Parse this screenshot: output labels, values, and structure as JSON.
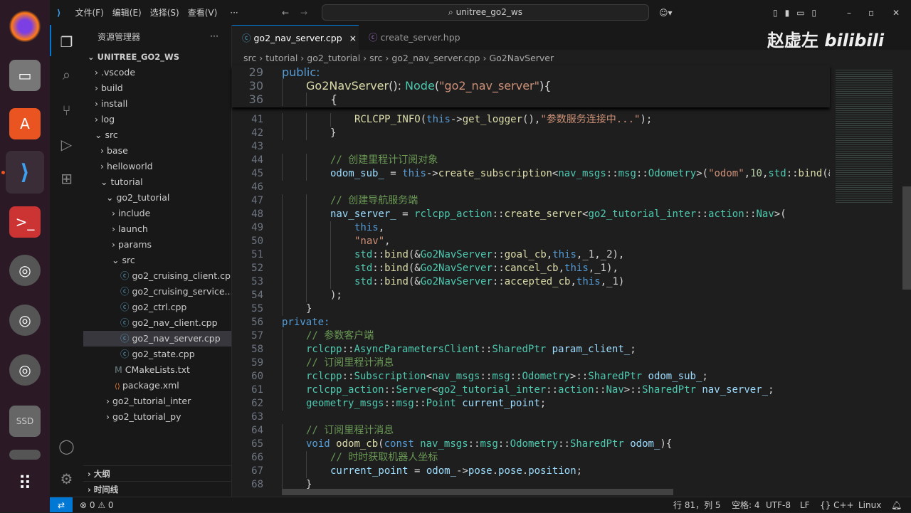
{
  "dock": {
    "items": [
      "firefox",
      "files",
      "app-center",
      "vscode",
      "terminal",
      "disk1",
      "disk2",
      "disk3",
      "ssd",
      "trash",
      "apps"
    ]
  },
  "titlebar": {
    "menus": [
      "文件(F)",
      "编辑(E)",
      "选择(S)",
      "查看(V)",
      "···"
    ],
    "search": "unitree_go2_ws"
  },
  "watermark": {
    "author": "赵虚左",
    "site": "bilibili"
  },
  "sidebar": {
    "title": "资源管理器",
    "more": "···",
    "root": "UNITREE_GO2_WS",
    "items": [
      {
        "label": ".vscode",
        "depth": 1,
        "kind": "folder",
        "open": false
      },
      {
        "label": "build",
        "depth": 1,
        "kind": "folder",
        "open": false
      },
      {
        "label": "install",
        "depth": 1,
        "kind": "folder",
        "open": false
      },
      {
        "label": "log",
        "depth": 1,
        "kind": "folder",
        "open": false
      },
      {
        "label": "src",
        "depth": 1,
        "kind": "folder",
        "open": true
      },
      {
        "label": "base",
        "depth": 2,
        "kind": "folder",
        "open": false
      },
      {
        "label": "helloworld",
        "depth": 2,
        "kind": "folder",
        "open": false
      },
      {
        "label": "tutorial",
        "depth": 2,
        "kind": "folder",
        "open": true
      },
      {
        "label": "go2_tutorial",
        "depth": 3,
        "kind": "folder",
        "open": true
      },
      {
        "label": "include",
        "depth": 4,
        "kind": "folder",
        "open": false
      },
      {
        "label": "launch",
        "depth": 4,
        "kind": "folder",
        "open": false
      },
      {
        "label": "params",
        "depth": 4,
        "kind": "folder",
        "open": false
      },
      {
        "label": "src",
        "depth": 4,
        "kind": "folder",
        "open": true
      },
      {
        "label": "go2_cruising_client.cpp",
        "depth": 5,
        "kind": "cpp"
      },
      {
        "label": "go2_cruising_service....",
        "depth": 5,
        "kind": "cpp"
      },
      {
        "label": "go2_ctrl.cpp",
        "depth": 5,
        "kind": "cpp"
      },
      {
        "label": "go2_nav_client.cpp",
        "depth": 5,
        "kind": "cpp"
      },
      {
        "label": "go2_nav_server.cpp",
        "depth": 5,
        "kind": "cpp",
        "active": true
      },
      {
        "label": "go2_state.cpp",
        "depth": 5,
        "kind": "cpp"
      },
      {
        "label": "CMakeLists.txt",
        "depth": 4,
        "kind": "cmake"
      },
      {
        "label": "package.xml",
        "depth": 4,
        "kind": "xml"
      },
      {
        "label": "go2_tutorial_inter",
        "depth": 3,
        "kind": "folder",
        "open": false
      },
      {
        "label": "go2_tutorial_py",
        "depth": 3,
        "kind": "folder",
        "open": false
      }
    ],
    "outline": "大纲",
    "timeline": "时间线"
  },
  "tabs": [
    {
      "label": "go2_nav_server.cpp",
      "active": true,
      "close": "×"
    },
    {
      "label": "create_server.hpp",
      "active": false
    }
  ],
  "breadcrumb": [
    "src",
    "tutorial",
    "go2_tutorial",
    "src",
    "go2_nav_server.cpp",
    "Go2NavServer"
  ],
  "sticky": [
    {
      "n": "29",
      "i": 0,
      "tok": [
        [
          "k",
          "public:"
        ]
      ]
    },
    {
      "n": "30",
      "i": 1,
      "tok": [
        [
          "f",
          "Go2NavServer"
        ],
        [
          "p",
          "(): "
        ],
        [
          "t",
          "Node"
        ],
        [
          "p",
          "("
        ],
        [
          "s",
          "\"go2_nav_server\""
        ],
        [
          "p",
          "){"
        ]
      ]
    },
    {
      "n": "36",
      "i": 2,
      "tok": [
        [
          "p",
          "{"
        ]
      ]
    }
  ],
  "code": [
    {
      "n": "41",
      "i": 3,
      "tok": [
        [
          "f",
          "RCLCPP_INFO"
        ],
        [
          "p",
          "("
        ],
        [
          "k",
          "this"
        ],
        [
          "p",
          "->"
        ],
        [
          "f",
          "get_logger"
        ],
        [
          "p",
          "(),"
        ],
        [
          "s",
          "\"参数服务连接中...\""
        ],
        [
          "p",
          ");"
        ]
      ]
    },
    {
      "n": "42",
      "i": 2,
      "tok": [
        [
          "p",
          "}"
        ]
      ]
    },
    {
      "n": "43",
      "i": 0,
      "tok": []
    },
    {
      "n": "44",
      "i": 2,
      "tok": [
        [
          "c",
          "// 创建里程计订阅对象"
        ]
      ]
    },
    {
      "n": "45",
      "i": 2,
      "tok": [
        [
          "v",
          "odom_sub_"
        ],
        [
          "p",
          " = "
        ],
        [
          "k",
          "this"
        ],
        [
          "p",
          "->"
        ],
        [
          "f",
          "create_subscription"
        ],
        [
          "p",
          "<"
        ],
        [
          "t",
          "nav_msgs"
        ],
        [
          "p",
          "::"
        ],
        [
          "t",
          "msg"
        ],
        [
          "p",
          "::"
        ],
        [
          "t",
          "Odometry"
        ],
        [
          "p",
          ">("
        ],
        [
          "s",
          "\"odom\""
        ],
        [
          "p",
          ","
        ],
        [
          "n",
          "10"
        ],
        [
          "p",
          ","
        ],
        [
          "t",
          "std"
        ],
        [
          "p",
          "::"
        ],
        [
          "f",
          "bind"
        ],
        [
          "p",
          "(&"
        ]
      ]
    },
    {
      "n": "46",
      "i": 0,
      "tok": []
    },
    {
      "n": "47",
      "i": 2,
      "tok": [
        [
          "c",
          "// 创建导航服务端"
        ]
      ]
    },
    {
      "n": "48",
      "i": 2,
      "tok": [
        [
          "v",
          "nav_server_"
        ],
        [
          "p",
          " = "
        ],
        [
          "t",
          "rclcpp_action"
        ],
        [
          "p",
          "::"
        ],
        [
          "f",
          "create_server"
        ],
        [
          "p",
          "<"
        ],
        [
          "t",
          "go2_tutorial_inter"
        ],
        [
          "p",
          "::"
        ],
        [
          "t",
          "action"
        ],
        [
          "p",
          "::"
        ],
        [
          "t",
          "Nav"
        ],
        [
          "p",
          ">("
        ]
      ]
    },
    {
      "n": "49",
      "i": 3,
      "tok": [
        [
          "k",
          "this"
        ],
        [
          "p",
          ","
        ]
      ]
    },
    {
      "n": "50",
      "i": 3,
      "tok": [
        [
          "s",
          "\"nav\""
        ],
        [
          "p",
          ","
        ]
      ]
    },
    {
      "n": "51",
      "i": 3,
      "tok": [
        [
          "t",
          "std"
        ],
        [
          "p",
          "::"
        ],
        [
          "f",
          "bind"
        ],
        [
          "p",
          "(&"
        ],
        [
          "t",
          "Go2NavServer"
        ],
        [
          "p",
          "::"
        ],
        [
          "f",
          "goal_cb"
        ],
        [
          "p",
          ","
        ],
        [
          "k",
          "this"
        ],
        [
          "p",
          ",_1,_2),"
        ]
      ]
    },
    {
      "n": "52",
      "i": 3,
      "tok": [
        [
          "t",
          "std"
        ],
        [
          "p",
          "::"
        ],
        [
          "f",
          "bind"
        ],
        [
          "p",
          "(&"
        ],
        [
          "t",
          "Go2NavServer"
        ],
        [
          "p",
          "::"
        ],
        [
          "f",
          "cancel_cb"
        ],
        [
          "p",
          ","
        ],
        [
          "k",
          "this"
        ],
        [
          "p",
          ",_1),"
        ]
      ]
    },
    {
      "n": "53",
      "i": 3,
      "tok": [
        [
          "t",
          "std"
        ],
        [
          "p",
          "::"
        ],
        [
          "f",
          "bind"
        ],
        [
          "p",
          "(&"
        ],
        [
          "t",
          "Go2NavServer"
        ],
        [
          "p",
          "::"
        ],
        [
          "f",
          "accepted_cb"
        ],
        [
          "p",
          ","
        ],
        [
          "k",
          "this"
        ],
        [
          "p",
          ",_1)"
        ]
      ]
    },
    {
      "n": "54",
      "i": 2,
      "tok": [
        [
          "p",
          ");"
        ]
      ]
    },
    {
      "n": "55",
      "i": 1,
      "tok": [
        [
          "p",
          "}"
        ]
      ]
    },
    {
      "n": "56",
      "i": 0,
      "tok": [
        [
          "k",
          "private:"
        ]
      ]
    },
    {
      "n": "57",
      "i": 1,
      "tok": [
        [
          "c",
          "// 参数客户端"
        ]
      ]
    },
    {
      "n": "58",
      "i": 1,
      "tok": [
        [
          "t",
          "rclcpp"
        ],
        [
          "p",
          "::"
        ],
        [
          "t",
          "AsyncParametersClient"
        ],
        [
          "p",
          "::"
        ],
        [
          "t",
          "SharedPtr"
        ],
        [
          "p",
          " "
        ],
        [
          "v",
          "param_client_"
        ],
        [
          "p",
          ";"
        ]
      ]
    },
    {
      "n": "59",
      "i": 1,
      "tok": [
        [
          "c",
          "// 订阅里程计消息"
        ]
      ]
    },
    {
      "n": "60",
      "i": 1,
      "tok": [
        [
          "t",
          "rclcpp"
        ],
        [
          "p",
          "::"
        ],
        [
          "t",
          "Subscription"
        ],
        [
          "p",
          "<"
        ],
        [
          "t",
          "nav_msgs"
        ],
        [
          "p",
          "::"
        ],
        [
          "t",
          "msg"
        ],
        [
          "p",
          "::"
        ],
        [
          "t",
          "Odometry"
        ],
        [
          "p",
          ">::"
        ],
        [
          "t",
          "SharedPtr"
        ],
        [
          "p",
          " "
        ],
        [
          "v",
          "odom_sub_"
        ],
        [
          "p",
          ";"
        ]
      ]
    },
    {
      "n": "61",
      "i": 1,
      "tok": [
        [
          "t",
          "rclcpp_action"
        ],
        [
          "p",
          "::"
        ],
        [
          "t",
          "Server"
        ],
        [
          "p",
          "<"
        ],
        [
          "t",
          "go2_tutorial_inter"
        ],
        [
          "p",
          "::"
        ],
        [
          "t",
          "action"
        ],
        [
          "p",
          "::"
        ],
        [
          "t",
          "Nav"
        ],
        [
          "p",
          ">::"
        ],
        [
          "t",
          "SharedPtr"
        ],
        [
          "p",
          " "
        ],
        [
          "v",
          "nav_server_"
        ],
        [
          "p",
          ";"
        ]
      ]
    },
    {
      "n": "62",
      "i": 1,
      "tok": [
        [
          "t",
          "geometry_msgs"
        ],
        [
          "p",
          "::"
        ],
        [
          "t",
          "msg"
        ],
        [
          "p",
          "::"
        ],
        [
          "t",
          "Point"
        ],
        [
          "p",
          " "
        ],
        [
          "v",
          "current_point"
        ],
        [
          "p",
          ";"
        ]
      ]
    },
    {
      "n": "63",
      "i": 0,
      "tok": []
    },
    {
      "n": "64",
      "i": 1,
      "tok": [
        [
          "c",
          "// 订阅里程计消息"
        ]
      ]
    },
    {
      "n": "65",
      "i": 1,
      "tok": [
        [
          "k",
          "void"
        ],
        [
          "p",
          " "
        ],
        [
          "f",
          "odom_cb"
        ],
        [
          "p",
          "("
        ],
        [
          "k",
          "const"
        ],
        [
          "p",
          " "
        ],
        [
          "t",
          "nav_msgs"
        ],
        [
          "p",
          "::"
        ],
        [
          "t",
          "msg"
        ],
        [
          "p",
          "::"
        ],
        [
          "t",
          "Odometry"
        ],
        [
          "p",
          "::"
        ],
        [
          "t",
          "SharedPtr"
        ],
        [
          "p",
          " "
        ],
        [
          "v",
          "odom_"
        ],
        [
          "p",
          "){"
        ]
      ]
    },
    {
      "n": "66",
      "i": 2,
      "tok": [
        [
          "c",
          "// 时时获取机器人坐标"
        ]
      ]
    },
    {
      "n": "67",
      "i": 2,
      "tok": [
        [
          "v",
          "current_point"
        ],
        [
          "p",
          " = "
        ],
        [
          "v",
          "odom_"
        ],
        [
          "p",
          "->"
        ],
        [
          "v",
          "pose"
        ],
        [
          "p",
          "."
        ],
        [
          "v",
          "pose"
        ],
        [
          "p",
          "."
        ],
        [
          "v",
          "position"
        ],
        [
          "p",
          ";"
        ]
      ]
    },
    {
      "n": "68",
      "i": 1,
      "tok": [
        [
          "p",
          "}"
        ]
      ]
    }
  ],
  "statusbar": {
    "errors": "0",
    "warnings": "0",
    "position": "行 81，列 5",
    "spaces": "空格: 4",
    "encoding": "UTF-8",
    "eol": "LF",
    "language": "{} C++",
    "platform": "Linux",
    "remote_icon": "⇄"
  },
  "colors": {
    "accent": "#0078d4",
    "statusRemote": "#0078d4"
  }
}
